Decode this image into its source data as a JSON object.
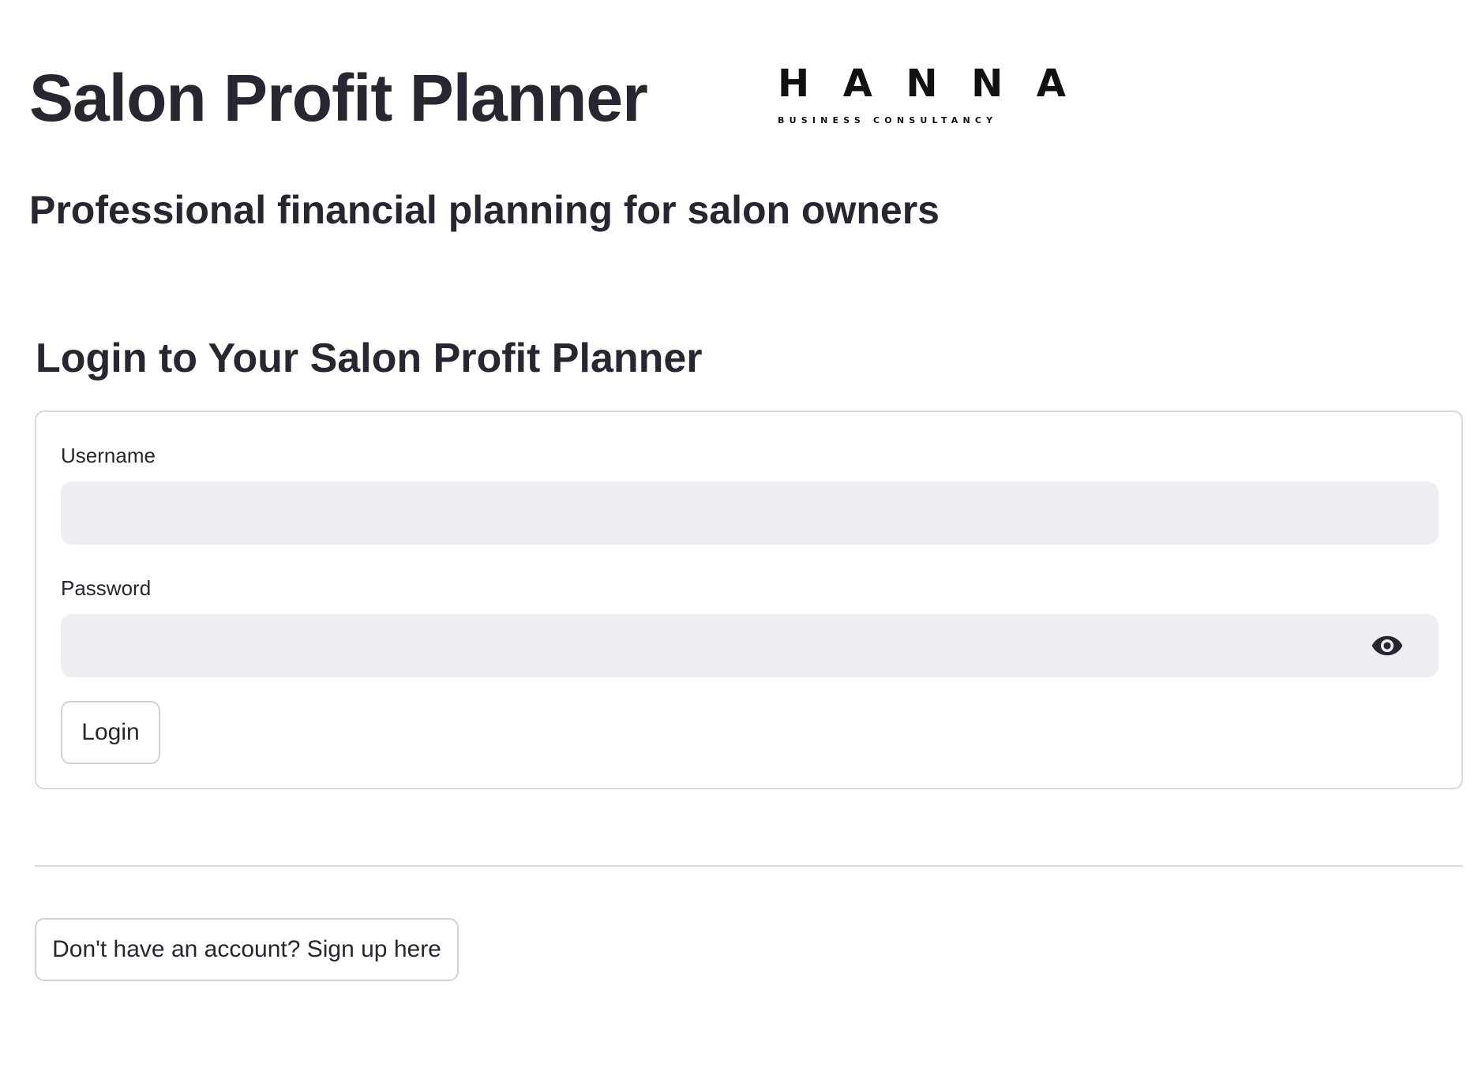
{
  "header": {
    "title": "Salon Profit Planner",
    "subtitle": "Professional financial planning for salon owners"
  },
  "logo": {
    "letters": [
      "H",
      "A",
      "N",
      "N",
      "A"
    ],
    "tagline": "BUSINESS CONSULTANCY"
  },
  "login": {
    "heading": "Login to Your Salon Profit Planner",
    "username_label": "Username",
    "username_value": "",
    "password_label": "Password",
    "password_value": "",
    "password_toggle_icon": "eye-icon",
    "submit_label": "Login"
  },
  "signup": {
    "button_label": "Don't have an account? Sign up here"
  },
  "colors": {
    "text": "#262730",
    "input_background": "#eceef2",
    "border": "#dadbe0",
    "background": "#ffffff"
  }
}
